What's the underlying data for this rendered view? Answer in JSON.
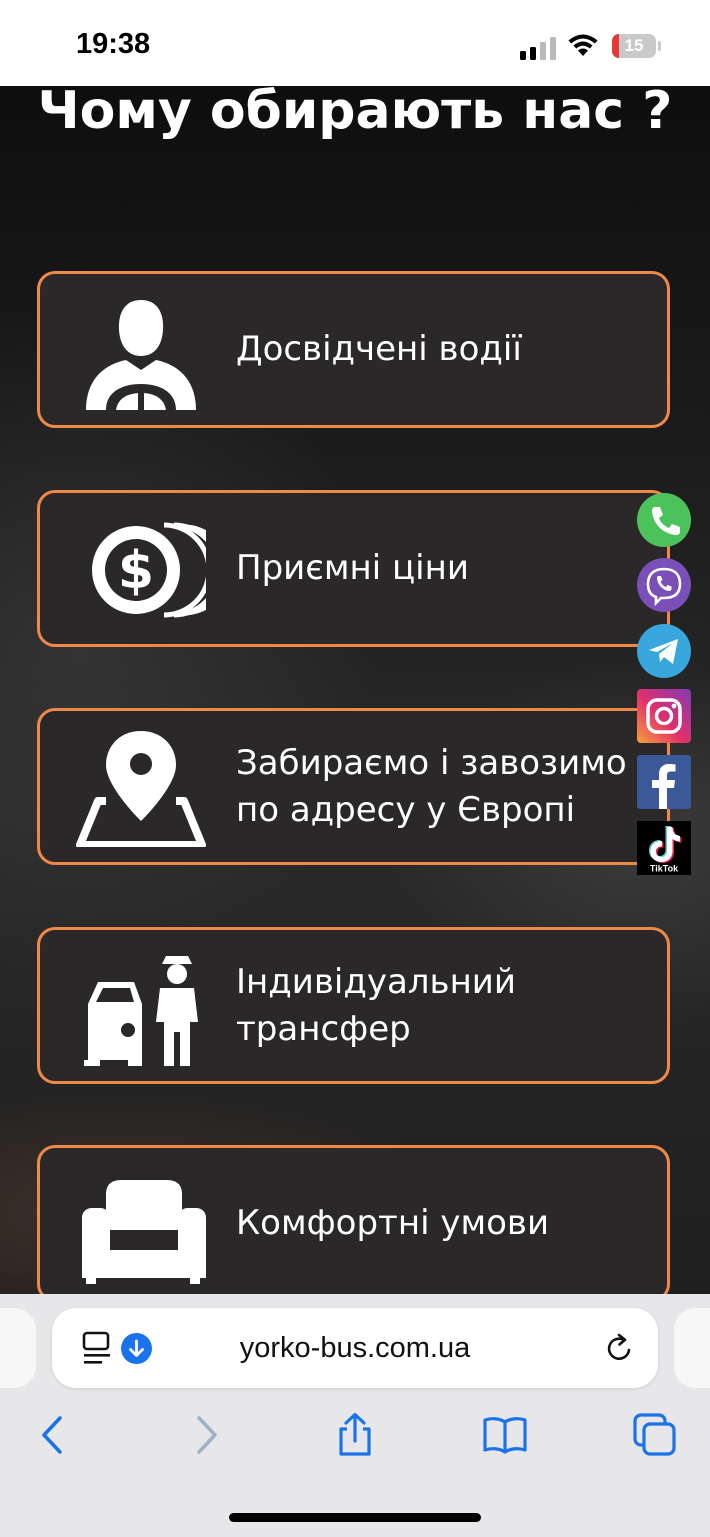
{
  "status_bar": {
    "time": "19:38",
    "battery_percent": "15",
    "battery_level": 0.15
  },
  "page": {
    "title": "Чому обирають нас ?",
    "cards": [
      {
        "label": "Досвідчені водії",
        "icon": "driver-icon"
      },
      {
        "label": "Приємні ціни",
        "icon": "dollar-coins-icon"
      },
      {
        "label": "Забираємо і завозимо по адресу у Європі",
        "icon": "map-pin-icon"
      },
      {
        "label": "Індивідуальний трансфер",
        "icon": "car-chauffeur-icon"
      },
      {
        "label": "Комфортні умови",
        "icon": "armchair-icon"
      }
    ]
  },
  "social": [
    {
      "name": "phone",
      "icon": "phone-icon",
      "color": "#4cc25a"
    },
    {
      "name": "viber",
      "icon": "viber-icon",
      "color": "#7a4fb7"
    },
    {
      "name": "telegram",
      "icon": "telegram-icon",
      "color": "#37a7dd"
    },
    {
      "name": "instagram",
      "icon": "instagram-icon",
      "color": "#d62d7a"
    },
    {
      "name": "facebook",
      "icon": "facebook-icon",
      "color": "#3b5998"
    },
    {
      "name": "tiktok",
      "icon": "tiktok-icon",
      "color": "#000000",
      "label": "TikTok"
    }
  ],
  "browser": {
    "url": "yorko-bus.com.ua",
    "accent": "#1a73e8"
  },
  "colors": {
    "card_border": "#f0884a",
    "card_bg": "#2b2829"
  }
}
